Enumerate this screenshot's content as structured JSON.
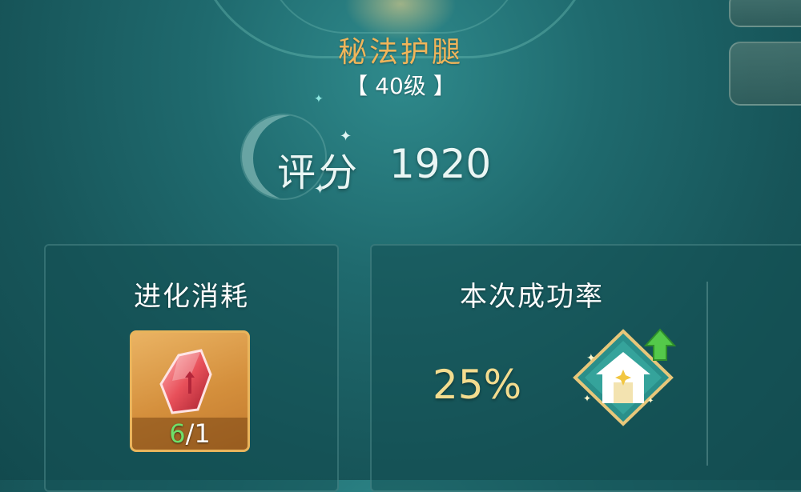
{
  "item": {
    "name": "秘法护腿",
    "level": "【 40级 】"
  },
  "score": {
    "label": "评分",
    "value": "1920"
  },
  "evolve_cost": {
    "title": "进化消耗",
    "material_icon": "red-crystal-icon",
    "count_have": "6",
    "count_sep": "/",
    "count_need": "1"
  },
  "success": {
    "title": "本次成功率",
    "rate": "25%",
    "boost_icon": "house-upgrade-icon"
  },
  "colors": {
    "title_gold": "#f0b55a",
    "rate_gold": "#f3dc8f",
    "count_green": "#6fe06a",
    "slot_orange": "#d48f3c"
  }
}
